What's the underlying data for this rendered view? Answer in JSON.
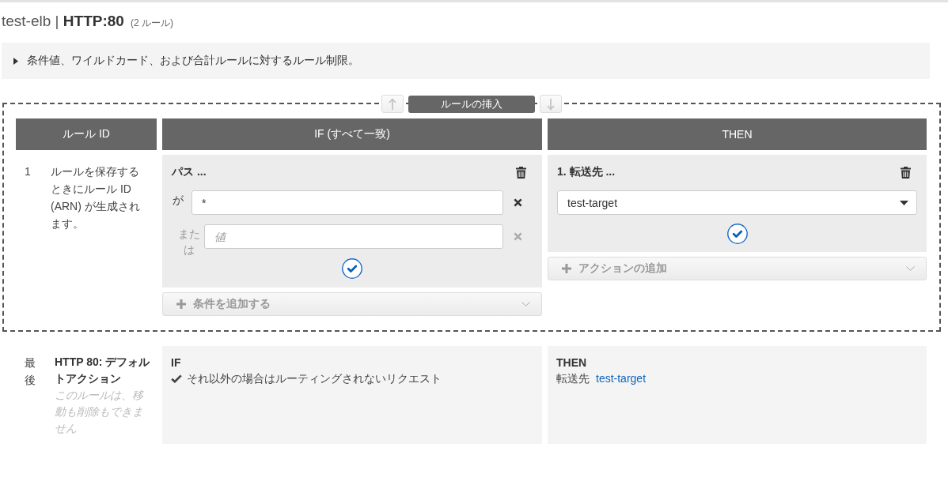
{
  "page_title": "test-elb | **HTTP:80**",
  "rule_count": "(2 ルール)",
  "limits_notice": {
    "text": "条件値、ワイルドカード、および合計ルールに対するルール制限。",
    "expanded": false
  },
  "insert_bar": {
    "label": "ルールの挿入",
    "move_buttons": [
      {
        "kind": "up",
        "disabled": true
      },
      {
        "kind": "down",
        "disabled": true
      }
    ]
  },
  "table": {
    "columns": [
      "ルール ID",
      "IF (すべて一致)",
      "THEN"
    ],
    "rules": [
      {
        "id": "1",
        "note": "ルールを保存するときにルール ID (ARN) が生成されます。",
        "conditions": [
          {
            "title": "パス ...",
            "values": [
              {
                "connector": "が",
                "value": "*",
                "removable": true
              },
              {
                "connector": "または",
                "placeholder": "値",
                "removable": false
              }
            ]
          }
        ],
        "add_condition": "条件を追加する",
        "actions": [
          {
            "title": "1. 転送先 ...",
            "target": "test-target"
          }
        ],
        "add_action": "アクションの追加"
      }
    ]
  },
  "default_rule": {
    "position": "最後",
    "title": "HTTP 80: デフォルトアクション",
    "note": "このルールは、移動も削除もできません",
    "if_label": "IF",
    "if_text": "それ以外の場合はルーティングされないリクエスト",
    "then_label": "THEN",
    "action": "転送先",
    "target": "test-target"
  }
}
